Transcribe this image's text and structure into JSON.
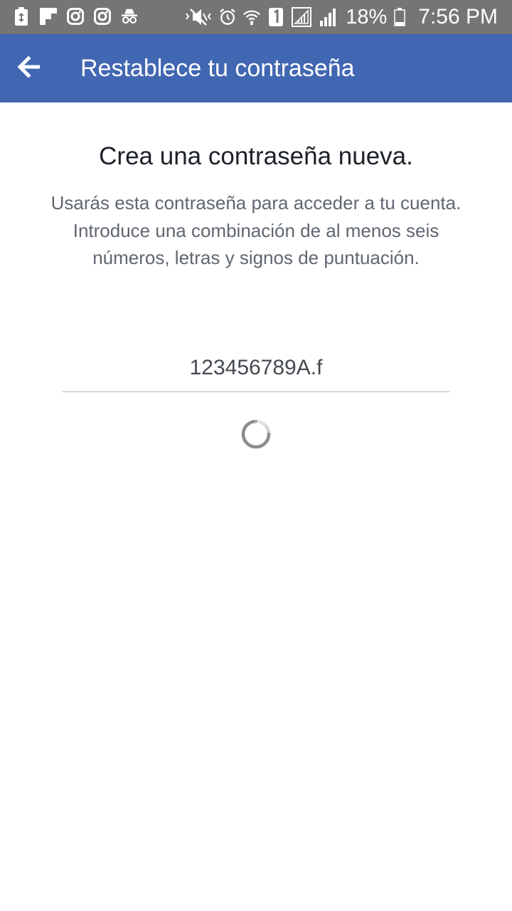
{
  "status_bar": {
    "left_icons": [
      "battery-saver-icon",
      "flipboard-icon",
      "instagram-icon",
      "instagram-icon",
      "incognito-icon"
    ],
    "right_icons": [
      "mute-icon",
      "alarm-icon",
      "wifi-icon",
      "sim-1-icon",
      "signal-sim1-icon",
      "signal-sim2-icon"
    ],
    "battery_percent": "18%",
    "time": "7:56 PM"
  },
  "app_bar": {
    "back_icon": "arrow-left-icon",
    "title": "Restablece tu contraseña",
    "color": "#4267b2"
  },
  "main": {
    "heading": "Crea una contraseña nueva.",
    "description_lines": [
      "Usarás esta contraseña para acceder a tu cuenta.",
      "Introduce una combinación de al menos seis números, letras y signos de puntuación."
    ],
    "password_value": "123456789A.f",
    "loading_icon": "spinner-icon"
  }
}
